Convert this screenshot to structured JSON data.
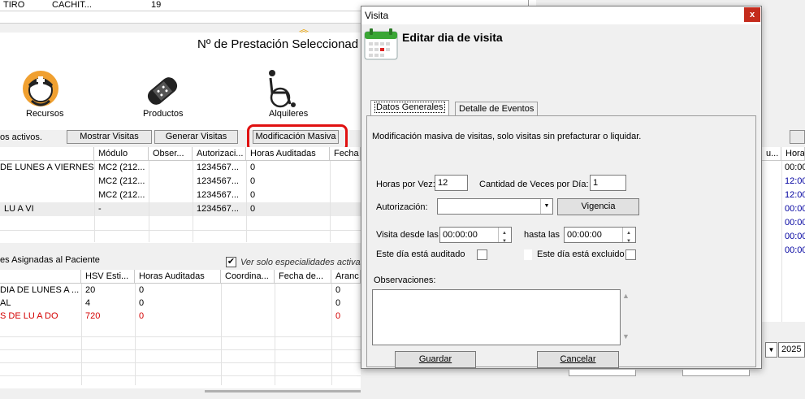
{
  "background": {
    "top_row": [
      "TIRO",
      "CACHIT...",
      "19"
    ],
    "prestacion_title": "Nº de Prestación Seleccionad",
    "toolbar": [
      {
        "label": "Recursos",
        "icon": "nurse-icon"
      },
      {
        "label": "Productos",
        "icon": "bandage-icon"
      },
      {
        "label": "Alquileres",
        "icon": "wheelchair-icon"
      }
    ],
    "activos_label": "os activos.",
    "buttons": {
      "mostrar": "Mostrar Visitas",
      "generar": "Generar Visitas",
      "modificacion": "Modificación Masiva"
    },
    "grid1": {
      "headers": [
        "Módulo",
        "Obser...",
        "Autorizaci...",
        "Horas Auditadas",
        "Fecha"
      ],
      "rows": [
        [
          "DE LUNES A VIERNES",
          "MC2 (212...",
          "",
          "1234567...",
          "0"
        ],
        [
          "",
          "MC2 (212...",
          "",
          "1234567...",
          "0"
        ],
        [
          "",
          "MC2 (212...",
          "",
          "1234567...",
          "0"
        ],
        [
          "LU A VI",
          "-",
          "",
          "1234567...",
          "0"
        ]
      ]
    },
    "especialidades_label": "es Asignadas al Paciente",
    "ver_solo_label": "Ver solo especialidades activas",
    "grid2": {
      "headers": [
        "HSV Esti...",
        "Horas Auditadas",
        "Coordina...",
        "Fecha de...",
        "Aranc"
      ],
      "rows": [
        {
          "cols": [
            "DIA DE LUNES A ...",
            "20",
            "0",
            "0"
          ],
          "red": false
        },
        {
          "cols": [
            "AL",
            "4",
            "0",
            "0"
          ],
          "red": false
        },
        {
          "cols": [
            "S DE LU A DO",
            "720",
            "0",
            "0"
          ],
          "red": true
        }
      ]
    },
    "right_grid": {
      "headers": [
        "u...",
        "Hora"
      ],
      "times": [
        "00:00",
        "12:00",
        "12:00",
        "00:00",
        "00:00",
        "00:00",
        "00:00"
      ],
      "year": "2025"
    }
  },
  "modal": {
    "title": "Visita",
    "close_label": "x",
    "header": "Editar dia de visita",
    "tabs": [
      "Datos Generales",
      "Detalle de Eventos"
    ],
    "description": "Modificación masiva de visitas, solo visitas sin prefacturar o liquidar.",
    "horas_por_vez_label": "Horas por Vez:",
    "horas_por_vez_value": "12",
    "cantidad_label": "Cantidad de Veces por Día:",
    "cantidad_value": "1",
    "autorizacion_label": "Autorización:",
    "autorizacion_value": "",
    "vigencia_label": "Vigencia",
    "visita_desde_label": "Visita desde las",
    "visita_desde_value": "00:00:00",
    "hasta_label": "hasta las",
    "hasta_value": "00:00:00",
    "auditado_label": "Este día está auditado",
    "excluido_label": "Este día está excluido",
    "observaciones_label": "Observaciones:",
    "observaciones_value": "",
    "guardar_label": "Guardar",
    "cancelar_label": "Cancelar"
  }
}
